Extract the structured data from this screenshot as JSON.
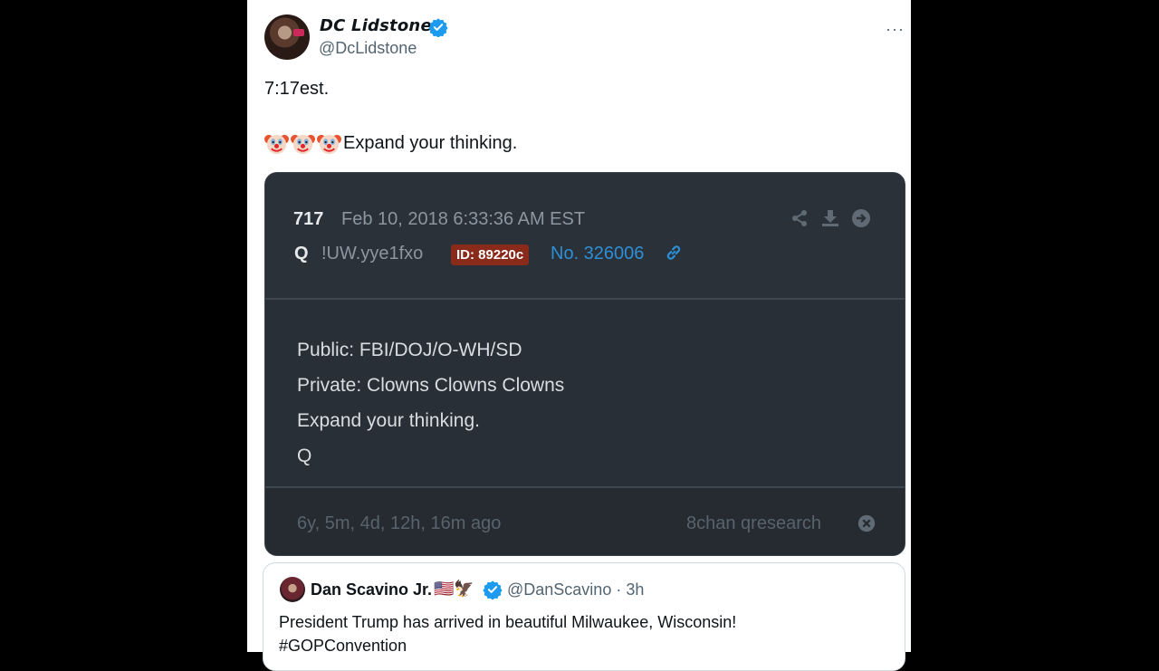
{
  "tweet": {
    "display_name": "DC Lidstone",
    "handle": "@DcLidstone",
    "more_label": "···",
    "line1": "7:17est.",
    "line2_text": "Expand your thinking.",
    "line2_emojis": [
      "clown-face",
      "clown-face",
      "clown-face"
    ]
  },
  "qpost": {
    "number": "717",
    "date": "Feb 10, 2018 6:33:36 AM EST",
    "author": "Q",
    "tripcode": "!UW.yye1fxo",
    "id_badge": "ID: 89220c",
    "post_no": "No. 326006",
    "icons": [
      "share-icon",
      "download-icon",
      "arrow-right-circle-icon",
      "link-icon",
      "close-circle-icon"
    ],
    "body": [
      "Public: FBI/DOJ/O-WH/SD",
      "Private: Clowns Clowns Clowns",
      "Expand your thinking.",
      "Q"
    ],
    "age": "6y, 5m, 4d, 12h, 16m ago",
    "source": "8chan qresearch",
    "colors": {
      "card_bg": "#292f36",
      "id_badge": "#8a2a1b",
      "link": "#2d8fd6"
    }
  },
  "embed": {
    "display_name": "Dan Scavino Jr.",
    "flags": "🇺🇸🦅",
    "handle_time": "@DanScavino · 3h",
    "text_line1": "President Trump has arrived in beautiful Milwaukee, Wisconsin!",
    "text_line2": "#GOPConvention"
  },
  "colors": {
    "verified": "#1d9bf0",
    "page_bg": "#000000"
  }
}
